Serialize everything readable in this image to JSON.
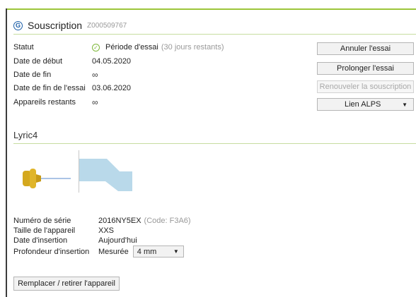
{
  "header": {
    "icon": "g-circle-icon",
    "title": "Souscription",
    "code": "Z000509767"
  },
  "subscription": {
    "status_label": "Statut",
    "status_value": "Période d'essai",
    "status_note": "(30 jours restants)",
    "start_label": "Date de début",
    "start_value": "04.05.2020",
    "end_label": "Date de fin",
    "end_value": "∞",
    "trial_end_label": "Date de fin de l'essai",
    "trial_end_value": "03.06.2020",
    "remaining_label": "Appareils restants",
    "remaining_value": "∞"
  },
  "actions": {
    "cancel_trial": "Annuler l'essai",
    "extend_trial": "Prolonger l'essai",
    "renew": "Renouveler la souscription",
    "alps_link": "Lien ALPS"
  },
  "device": {
    "section_title": "Lyric4",
    "serial_label": "Numéro de série",
    "serial_value": "2016NY5EX",
    "serial_code": "(Code: F3A6)",
    "size_label": "Taille de l'appareil",
    "size_value": "XXS",
    "insertion_date_label": "Date d'insertion",
    "insertion_date_value": "Aujourd'hui",
    "depth_label": "Profondeur d'insertion",
    "depth_mode": "Mesurée",
    "depth_value": "4 mm",
    "replace_button": "Remplacer / retirer l'appareil"
  },
  "colors": {
    "accent_green": "#9cc63b",
    "icon_blue": "#1d5fa8",
    "device_gold": "#d4a81e",
    "canal_blue": "#b9d9ea"
  }
}
